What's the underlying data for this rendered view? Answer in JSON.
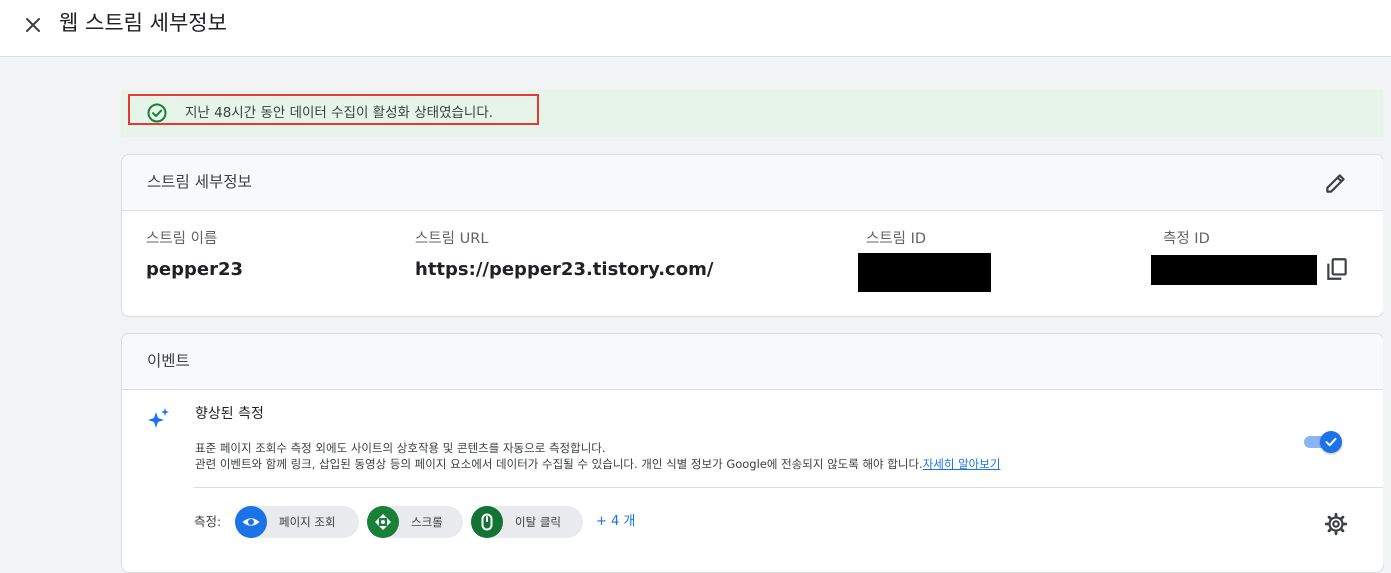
{
  "header": {
    "title": "웹 스트림 세부정보"
  },
  "banner": {
    "text": "지난 48시간 동안 데이터 수집이 활성화 상태였습니다."
  },
  "stream_details": {
    "title": "스트림 세부정보",
    "fields": [
      {
        "label": "스트림 이름",
        "value": "pepper23"
      },
      {
        "label": "스트림 URL",
        "value": "https://pepper23.tistory.com/"
      },
      {
        "label": "스트림 ID",
        "value": ""
      },
      {
        "label": "측정 ID",
        "value": ""
      }
    ]
  },
  "events": {
    "title": "이벤트",
    "enhanced": {
      "title": "향상된 측정",
      "desc_line1": "표준 페이지 조회수 측정 외에도 사이트의 상호작용 및 콘텐츠를 자동으로 측정합니다.",
      "desc_line2": "관련 이벤트와 함께 링크, 삽입된 동영상 등의 페이지 요소에서 데이터가 수집될 수 있습니다. 개인 식별 정보가 Google에 전송되지 않도록 해야 합니다.",
      "learn_more": "자세히 알아보기",
      "enabled": true
    },
    "measurements": {
      "label": "측정:",
      "chips": [
        {
          "label": "페이지 조회",
          "icon": "eye-icon",
          "color": "#1a73e8"
        },
        {
          "label": "스크롤",
          "icon": "scroll-arrows-icon",
          "color": "#188038"
        },
        {
          "label": "이탈 클릭",
          "icon": "mouse-icon",
          "color": "#137333"
        }
      ],
      "more": "+ 4 개"
    }
  },
  "colors": {
    "accent": "#1a73e8",
    "success_bg": "#e6f4ea",
    "success_icon": "#188038",
    "highlight": "#e53935"
  }
}
